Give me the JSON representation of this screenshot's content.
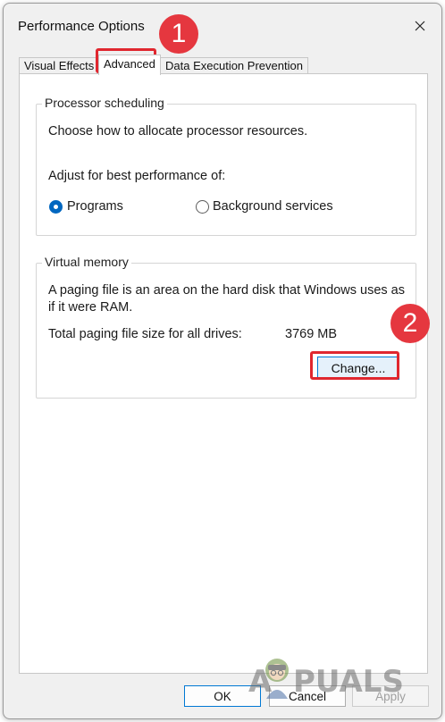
{
  "window": {
    "title": "Performance Options"
  },
  "tabs": [
    {
      "label": "Visual Effects",
      "active": false
    },
    {
      "label": "Advanced",
      "active": true
    },
    {
      "label": "Data Execution Prevention",
      "active": false
    }
  ],
  "processor_scheduling": {
    "title": "Processor scheduling",
    "description": "Choose how to allocate processor resources.",
    "adjust_label": "Adjust for best performance of:",
    "options": [
      {
        "label": "Programs",
        "selected": true
      },
      {
        "label": "Background services",
        "selected": false
      }
    ]
  },
  "virtual_memory": {
    "title": "Virtual memory",
    "description": "A paging file is an area on the hard disk that Windows uses as if it were RAM.",
    "total_label": "Total paging file size for all drives:",
    "total_value": "3769 MB",
    "change_label": "Change..."
  },
  "footer": {
    "ok_label": "OK",
    "cancel_label": "Cancel",
    "apply_label": "Apply"
  },
  "annotations": {
    "step1": "1",
    "step2": "2",
    "color": "#e0272f"
  },
  "watermark": {
    "text": "APPUALS"
  }
}
